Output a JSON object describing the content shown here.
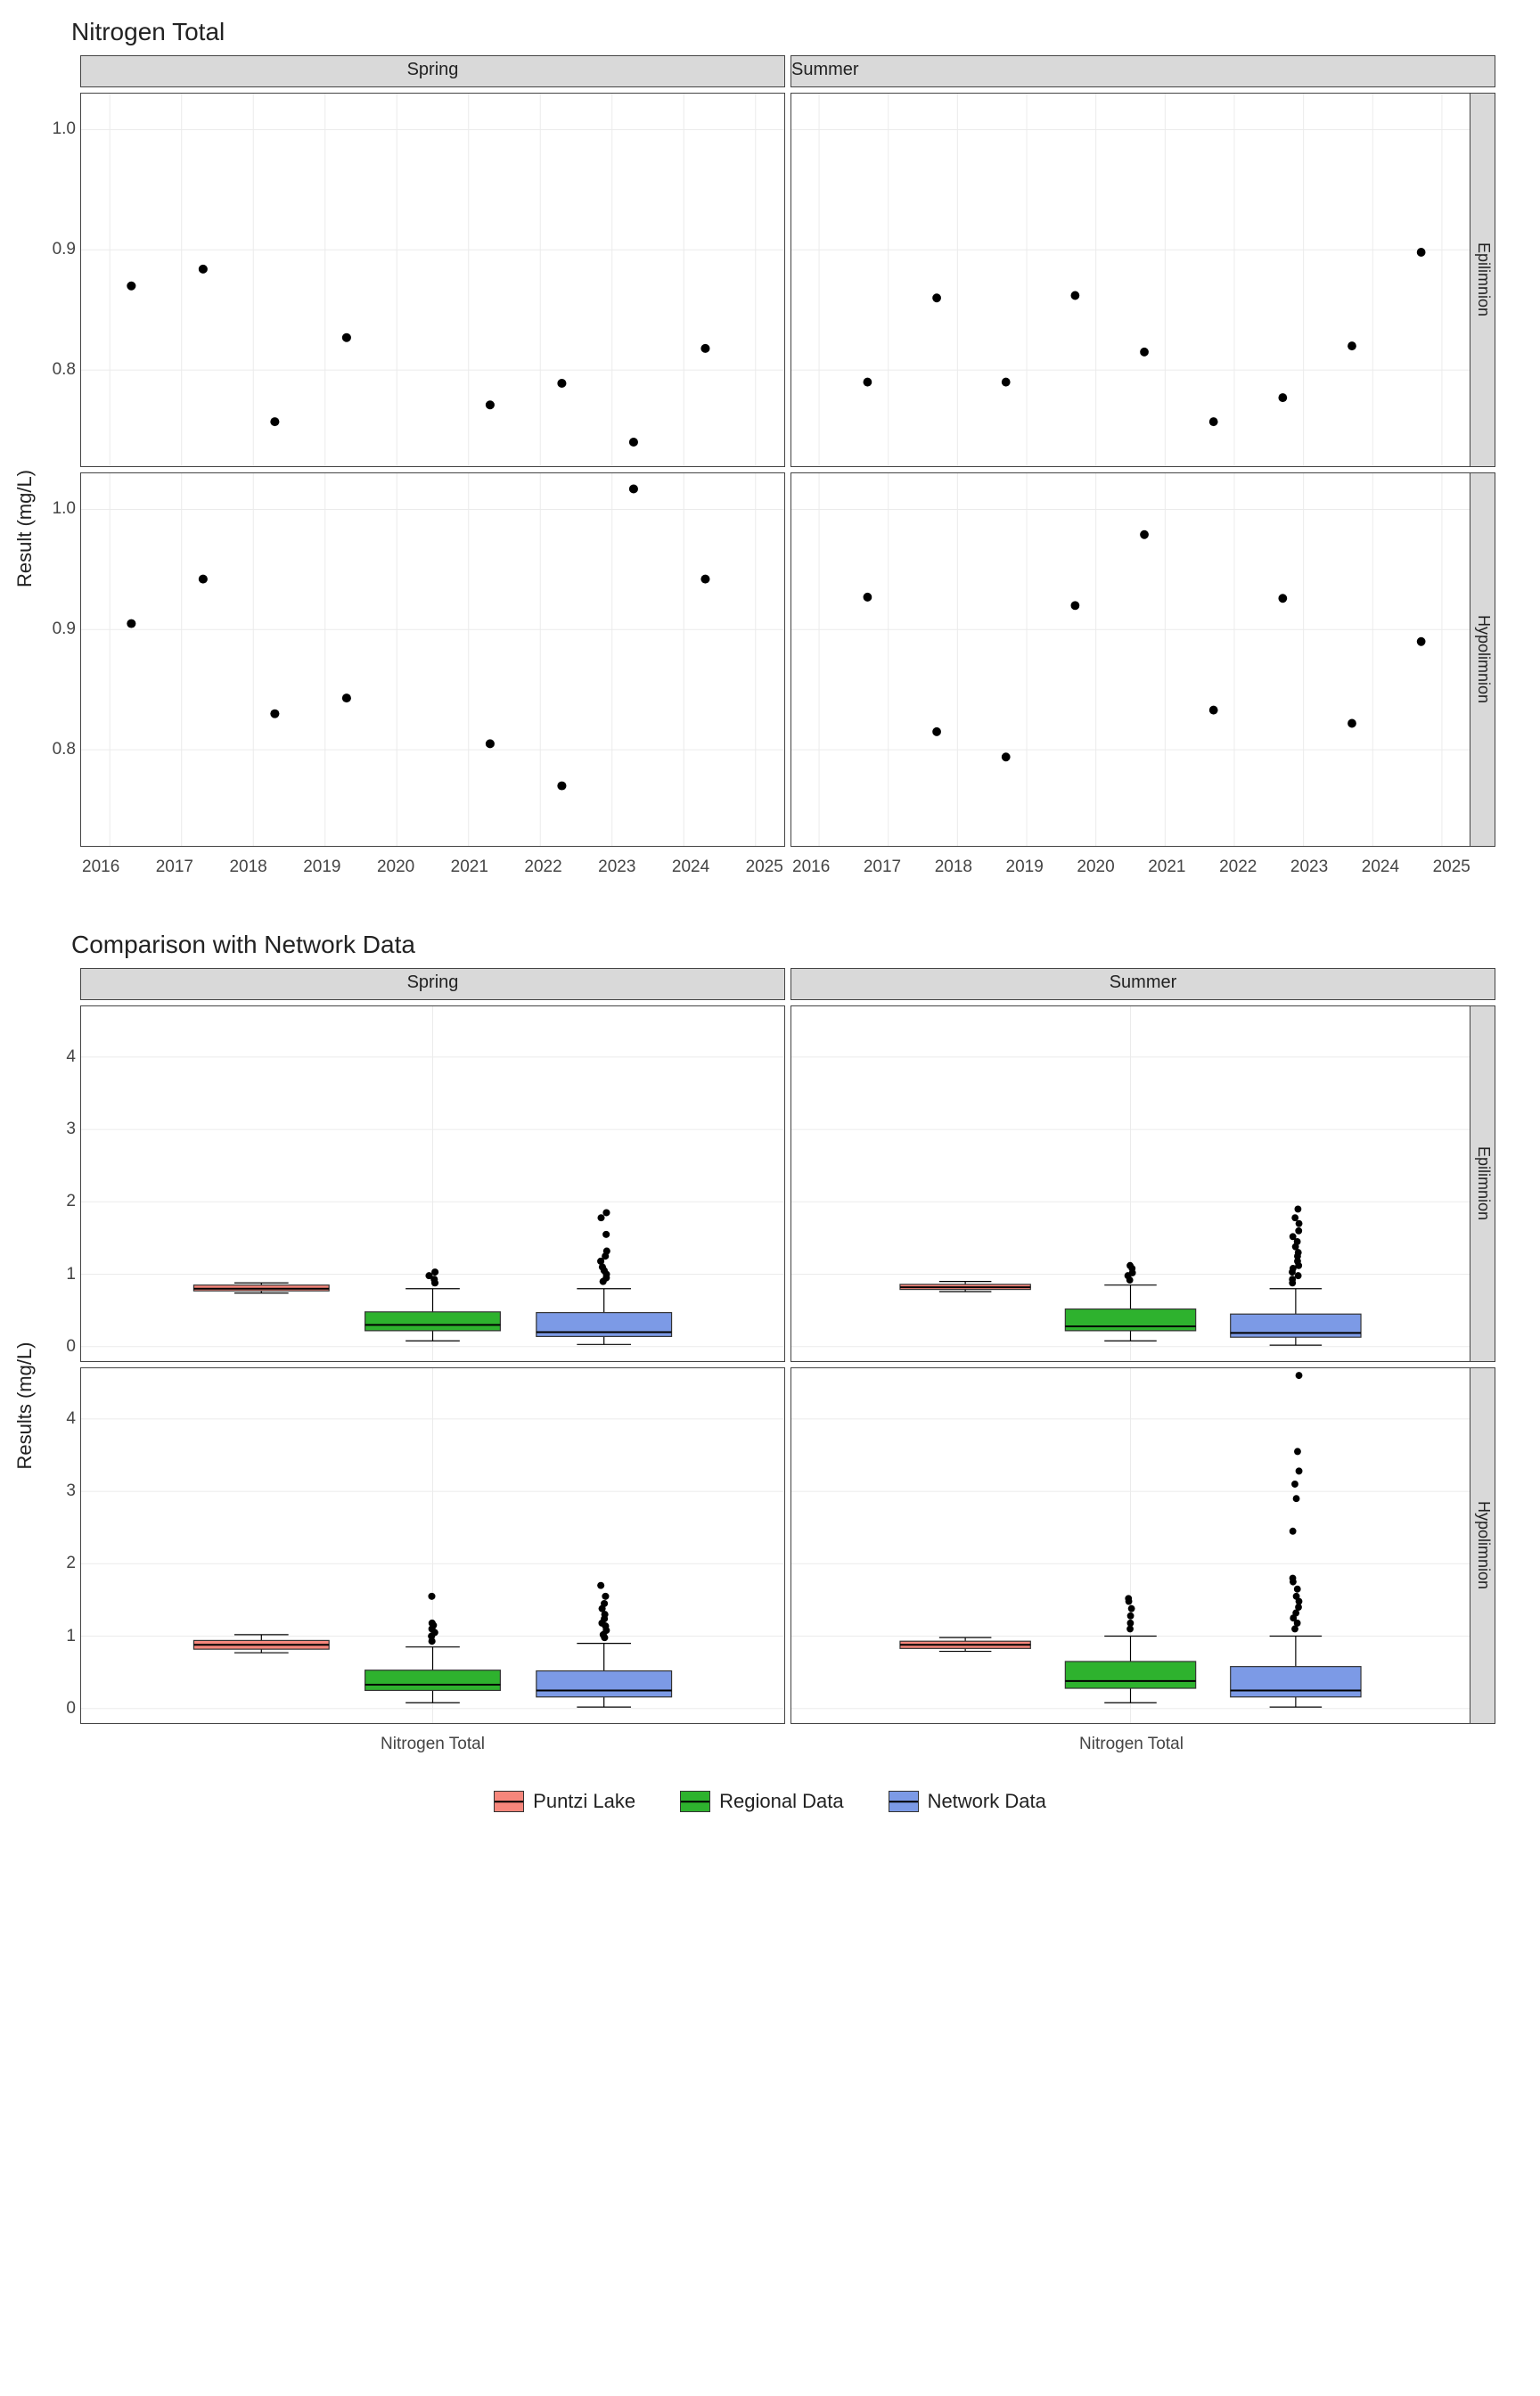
{
  "chart_data": [
    {
      "type": "scatter",
      "title": "Nitrogen Total",
      "ylabel": "Result (mg/L)",
      "facets_col": [
        "Spring",
        "Summer"
      ],
      "facets_row": [
        "Epilimnion",
        "Hypolimnion"
      ],
      "x_ticks": [
        "2016",
        "2017",
        "2018",
        "2019",
        "2020",
        "2021",
        "2022",
        "2023",
        "2024",
        "2025"
      ],
      "ylim": [
        0.72,
        1.03
      ],
      "y_ticks": [
        0.8,
        0.9,
        1.0
      ],
      "panels": {
        "Spring|Epilimnion": {
          "x": [
            2016.3,
            2017.3,
            2018.3,
            2019.3,
            2021.3,
            2022.3,
            2023.3,
            2024.3
          ],
          "y": [
            0.87,
            0.884,
            0.757,
            0.827,
            0.771,
            0.789,
            0.74,
            0.818
          ]
        },
        "Summer|Epilimnion": {
          "x": [
            2016.7,
            2017.7,
            2018.7,
            2019.7,
            2020.7,
            2021.7,
            2022.7,
            2023.7,
            2024.7
          ],
          "y": [
            0.79,
            0.86,
            0.79,
            0.862,
            0.815,
            0.757,
            0.777,
            0.82,
            0.898
          ]
        },
        "Spring|Hypolimnion": {
          "x": [
            2016.3,
            2017.3,
            2018.3,
            2019.3,
            2021.3,
            2022.3,
            2023.3,
            2024.3
          ],
          "y": [
            0.905,
            0.942,
            0.83,
            0.843,
            0.805,
            0.77,
            1.017,
            0.942
          ]
        },
        "Summer|Hypolimnion": {
          "x": [
            2016.7,
            2017.7,
            2018.7,
            2019.7,
            2020.7,
            2021.7,
            2022.7,
            2023.7,
            2024.7
          ],
          "y": [
            0.927,
            0.815,
            0.794,
            0.92,
            0.979,
            0.833,
            0.926,
            0.822,
            0.89
          ]
        }
      }
    },
    {
      "type": "boxplot",
      "title": "Comparison with Network Data",
      "ylabel": "Results (mg/L)",
      "facets_col": [
        "Spring",
        "Summer"
      ],
      "facets_row": [
        "Epilimnion",
        "Hypolimnion"
      ],
      "x_category": "Nitrogen Total",
      "ylim": [
        -0.2,
        4.7
      ],
      "y_ticks": [
        0,
        1,
        2,
        3,
        4
      ],
      "series": [
        {
          "name": "Puntzi Lake",
          "color": "#f6867b"
        },
        {
          "name": "Regional Data",
          "color": "#2eb22e"
        },
        {
          "name": "Network Data",
          "color": "#7c9ae6"
        }
      ],
      "panels": {
        "Spring|Epilimnion": {
          "boxes": [
            {
              "series": "Puntzi Lake",
              "min": 0.74,
              "q1": 0.77,
              "med": 0.8,
              "q3": 0.85,
              "max": 0.88,
              "outliers": []
            },
            {
              "series": "Regional Data",
              "min": 0.08,
              "q1": 0.22,
              "med": 0.3,
              "q3": 0.48,
              "max": 0.8,
              "outliers": [
                0.88,
                0.93,
                0.98,
                1.03
              ]
            },
            {
              "series": "Network Data",
              "min": 0.03,
              "q1": 0.14,
              "med": 0.2,
              "q3": 0.47,
              "max": 0.8,
              "outliers": [
                0.9,
                0.95,
                1.0,
                1.05,
                1.1,
                1.18,
                1.25,
                1.32,
                1.55,
                1.78,
                1.85
              ]
            }
          ]
        },
        "Summer|Epilimnion": {
          "boxes": [
            {
              "series": "Puntzi Lake",
              "min": 0.76,
              "q1": 0.79,
              "med": 0.82,
              "q3": 0.86,
              "max": 0.9,
              "outliers": []
            },
            {
              "series": "Regional Data",
              "min": 0.08,
              "q1": 0.22,
              "med": 0.28,
              "q3": 0.52,
              "max": 0.85,
              "outliers": [
                0.92,
                0.98,
                1.02,
                1.08,
                1.12
              ]
            },
            {
              "series": "Network Data",
              "min": 0.02,
              "q1": 0.13,
              "med": 0.19,
              "q3": 0.45,
              "max": 0.8,
              "outliers": [
                0.88,
                0.93,
                0.98,
                1.03,
                1.08,
                1.12,
                1.18,
                1.25,
                1.3,
                1.38,
                1.45,
                1.52,
                1.6,
                1.7,
                1.78,
                1.9
              ]
            }
          ]
        },
        "Spring|Hypolimnion": {
          "boxes": [
            {
              "series": "Puntzi Lake",
              "min": 0.77,
              "q1": 0.82,
              "med": 0.88,
              "q3": 0.94,
              "max": 1.02,
              "outliers": []
            },
            {
              "series": "Regional Data",
              "min": 0.08,
              "q1": 0.25,
              "med": 0.33,
              "q3": 0.53,
              "max": 0.85,
              "outliers": [
                0.93,
                1.0,
                1.05,
                1.1,
                1.15,
                1.18,
                1.55
              ]
            },
            {
              "series": "Network Data",
              "min": 0.02,
              "q1": 0.16,
              "med": 0.25,
              "q3": 0.52,
              "max": 0.9,
              "outliers": [
                0.98,
                1.02,
                1.08,
                1.14,
                1.18,
                1.24,
                1.3,
                1.38,
                1.45,
                1.55,
                1.7
              ]
            }
          ]
        },
        "Summer|Hypolimnion": {
          "boxes": [
            {
              "series": "Puntzi Lake",
              "min": 0.79,
              "q1": 0.83,
              "med": 0.88,
              "q3": 0.93,
              "max": 0.98,
              "outliers": []
            },
            {
              "series": "Regional Data",
              "min": 0.08,
              "q1": 0.28,
              "med": 0.38,
              "q3": 0.65,
              "max": 1.0,
              "outliers": [
                1.1,
                1.18,
                1.28,
                1.38,
                1.48,
                1.52
              ]
            },
            {
              "series": "Network Data",
              "min": 0.02,
              "q1": 0.16,
              "med": 0.25,
              "q3": 0.58,
              "max": 1.0,
              "outliers": [
                1.1,
                1.18,
                1.25,
                1.32,
                1.4,
                1.48,
                1.55,
                1.65,
                1.75,
                1.8,
                2.45,
                2.9,
                3.1,
                3.28,
                3.55,
                4.6
              ]
            }
          ]
        }
      }
    }
  ],
  "legend": {
    "items": [
      "Puntzi Lake",
      "Regional Data",
      "Network Data"
    ],
    "colors": [
      "#f6867b",
      "#2eb22e",
      "#7c9ae6"
    ]
  }
}
